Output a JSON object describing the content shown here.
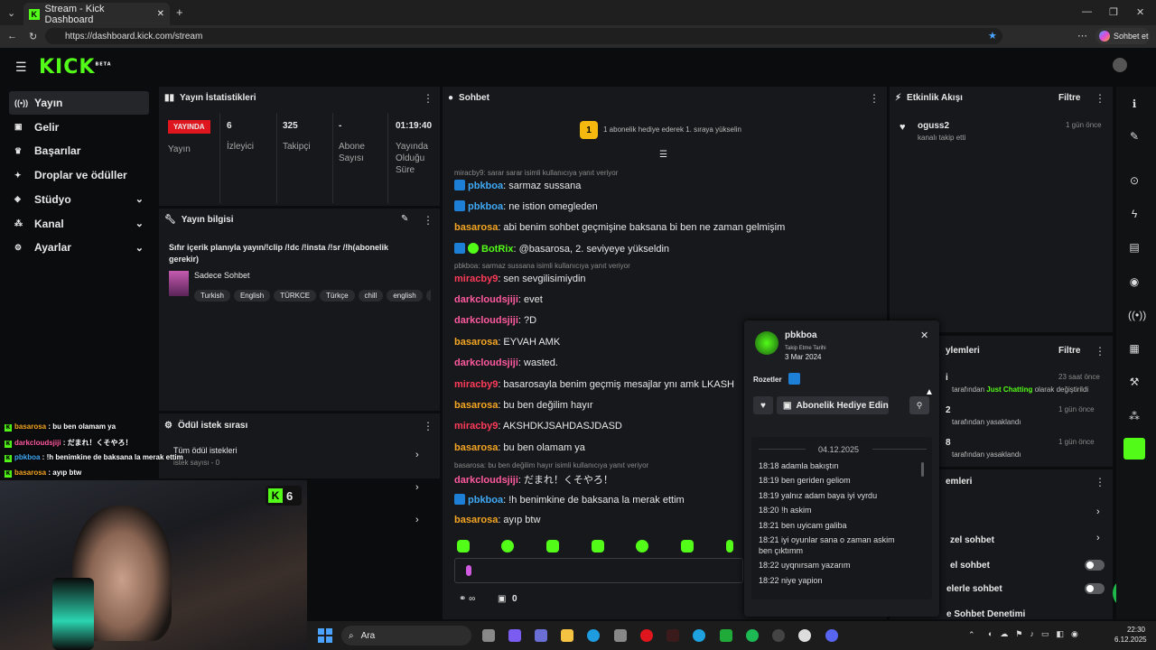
{
  "browser": {
    "tab_title": "Stream - Kick Dashboard",
    "url": "https://dashboard.kick.com/stream",
    "profile_label": "Sohbet et"
  },
  "app": {
    "logo": "KICK",
    "logo_sup": "BETA"
  },
  "sidebar": {
    "items": [
      {
        "label": "Yayın",
        "icon": "broadcast-icon"
      },
      {
        "label": "Gelir",
        "icon": "income-icon"
      },
      {
        "label": "Başarılar",
        "icon": "trophy-icon"
      },
      {
        "label": "Droplar ve ödüller",
        "icon": "gift-icon"
      },
      {
        "label": "Stüdyo",
        "icon": "studio-icon"
      },
      {
        "label": "Kanal",
        "icon": "channel-icon"
      },
      {
        "label": "Ayarlar",
        "icon": "gear-icon"
      }
    ]
  },
  "stats": {
    "title": "Yayın İstatistikleri",
    "live_badge": "YAYINDA",
    "live_label": "Yayın",
    "viewers_value": "6",
    "viewers_label": "İzleyici",
    "followers_value": "325",
    "followers_label": "Takipçi",
    "subs_value": "-",
    "subs_label1": "Abone",
    "subs_label2": "Sayısı",
    "time_value": "01:19:40",
    "time_label1": "Yayında",
    "time_label2": "Olduğu",
    "time_label3": "Süre"
  },
  "info": {
    "title": "Yayın bilgisi",
    "stream_title1": "Sıfır içerik planıyla yayın/!clip /!dc /!insta /!sr /!h(abonelik",
    "stream_title2": "gerekir)",
    "category": "Sadece Sohbet",
    "tags": [
      "Turkish",
      "English",
      "TÜRKCE",
      "Türkçe",
      "chill",
      "english",
      "t"
    ]
  },
  "rewards": {
    "title": "Ödül istek sırası",
    "all_label": "Tüm ödül istekleri",
    "count_label": "istek sayısı - 0"
  },
  "chat": {
    "title": "Sohbet",
    "gift_banner": "1 abonelik hediye ederek 1. sıraya yükselin",
    "gift_rank": "1",
    "lines": [
      {
        "reply": "miracby9: sarar sarar isimli kullanıcıya yanıt veriyor"
      },
      {
        "user": "pbkboa",
        "color": "u-b",
        "badge": "blue",
        "text": ": sarmaz sussana"
      },
      {
        "user": "pbkboa",
        "color": "u-b",
        "badge": "blue",
        "text": ": ne istion omegleden"
      },
      {
        "user": "basarosa",
        "color": "u-o",
        "text": ": abi benim sohbet geçmişine baksana bi ben ne zaman gelmişim"
      },
      {
        "user": "BotRix",
        "color": "u-g",
        "badge": "both",
        "text": ": @basarosa, 2. seviyeye yükseldin"
      },
      {
        "reply": "pbkboa: sarmaz sussana isimli kullanıcıya yanıt veriyor"
      },
      {
        "user": "miracby9",
        "color": "u-r",
        "text": ": sen sevgilisimiydin"
      },
      {
        "user": "darkcloudsjiji",
        "color": "u-p",
        "text": ": evet"
      },
      {
        "user": "darkcloudsjiji",
        "color": "u-p",
        "text": ": ?D"
      },
      {
        "user": "basarosa",
        "color": "u-o",
        "text": ": EYVAH AMK"
      },
      {
        "user": "darkcloudsjiji",
        "color": "u-p",
        "text": ": wasted."
      },
      {
        "user": "miracby9",
        "color": "u-r",
        "text": ": basarosayla benim geçmiş mesajlar ynı amk LKASH"
      },
      {
        "user": "basarosa",
        "color": "u-o",
        "text": ": bu ben değilim hayır"
      },
      {
        "user": "miracby9",
        "color": "u-r",
        "text": ": AKSHDKJSAHDASJDASD"
      },
      {
        "user": "basarosa",
        "color": "u-o",
        "text": ": bu ben olamam ya"
      },
      {
        "reply": "basarosa: bu ben değilim hayır isimli kullanıcıya yanıt veriyor"
      },
      {
        "user": "darkcloudsjiji",
        "color": "u-p",
        "text": ": だまれ！くそやろ！"
      },
      {
        "user": "pbkboa",
        "color": "u-b",
        "badge": "blue",
        "text": ": !h benimkine de baksana la merak ettim"
      },
      {
        "user": "basarosa",
        "color": "u-o",
        "text": ": ayıp btw"
      }
    ],
    "footer_count": "0"
  },
  "activity": {
    "title": "Etkinlik Akışı",
    "filter": "Filtre",
    "item_user": "oguss2",
    "item_text": "kanalı takip etti",
    "item_time": "1 gün önce"
  },
  "actions": {
    "title": "ylemleri",
    "filter": "Filtre",
    "rows": [
      {
        "prefix": "i",
        "line": "tarafından Just Chatting olarak değiştirildi",
        "time": "23 saat önce"
      },
      {
        "prefix": "2",
        "line": "tarafından yasaklandı",
        "time": "1 gün önce"
      },
      {
        "prefix": "8",
        "line": "tarafından yasaklandı",
        "time": "1 gün önce"
      }
    ]
  },
  "chatsettings": {
    "title": "emleri",
    "rows": [
      "zel sohbet",
      "el sohbet",
      "elerle sohbet",
      "e Sohbet Denetimi"
    ]
  },
  "popup": {
    "username": "pbkboa",
    "follow_label": "Takip Etme Tarihi",
    "follow_date": "3 Mar 2024",
    "badges_label": "Rozetler",
    "gift_button": "Abonelik Hediye Edin",
    "date_header": "04.12.2025",
    "history": [
      "18:18 adamla bakıştın",
      "18:19 ben geriden geliom",
      "18:19 yalnız adam baya iyi vyrdu",
      "18:20 !h askim",
      "18:21 ben uyicam galiba",
      "18:21 iyi oyunlar sana o zaman askim",
      "ben çıktımm",
      "18:22 uyqnırsam yazarım",
      "18:22 niye yapion"
    ]
  },
  "overlay": {
    "lines": [
      {
        "user": "basarosa",
        "text": " : bu ben olamam ya"
      },
      {
        "user": "darkcloudsjiji",
        "text": " : だまれ！くそやろ！"
      },
      {
        "user": "pbkboa",
        "text": " : !h benimkine de baksana la merak ettim"
      },
      {
        "user": "basarosa",
        "text": " : ayıp btw"
      }
    ],
    "viewer_count": "6"
  },
  "taskbar": {
    "search": "Ara",
    "time": "22:30",
    "date": "6.12.2025"
  }
}
